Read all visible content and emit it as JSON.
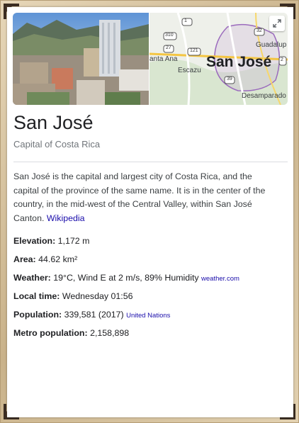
{
  "entity": {
    "title": "San José",
    "subtitle": "Capital of Costa Rica"
  },
  "map": {
    "label_main": "San José",
    "places": {
      "guadalupe": "Guadalup",
      "ana": "anta Ana",
      "escazu": "Escazu",
      "desamparados": "Desamparado"
    },
    "road_shields": [
      "1",
      "310",
      "27",
      "121",
      "39",
      "32",
      "2"
    ]
  },
  "description": {
    "text": "San José is the capital and largest city of Costa Rica, and the capital of the province of the same name. It is in the center of the country, in the mid-west of the Central Valley, within San José Canton. ",
    "source": "Wikipedia"
  },
  "facts": [
    {
      "label": "Elevation:",
      "value": " 1,172 m",
      "source": ""
    },
    {
      "label": "Area:",
      "value": " 44.62 km²",
      "source": ""
    },
    {
      "label": "Weather:",
      "value": " 19°C, Wind E at 2 m/s, 89% Humidity ",
      "source": "weather.com"
    },
    {
      "label": "Local time:",
      "value": " Wednesday 01:56",
      "source": ""
    },
    {
      "label": "Population:",
      "value": " 339,581 (2017) ",
      "source": "United Nations"
    },
    {
      "label": "Metro population:",
      "value": " 2,158,898",
      "source": ""
    }
  ],
  "icons": {
    "expand": "expand-icon",
    "corners": "corner-ornament-icon"
  }
}
